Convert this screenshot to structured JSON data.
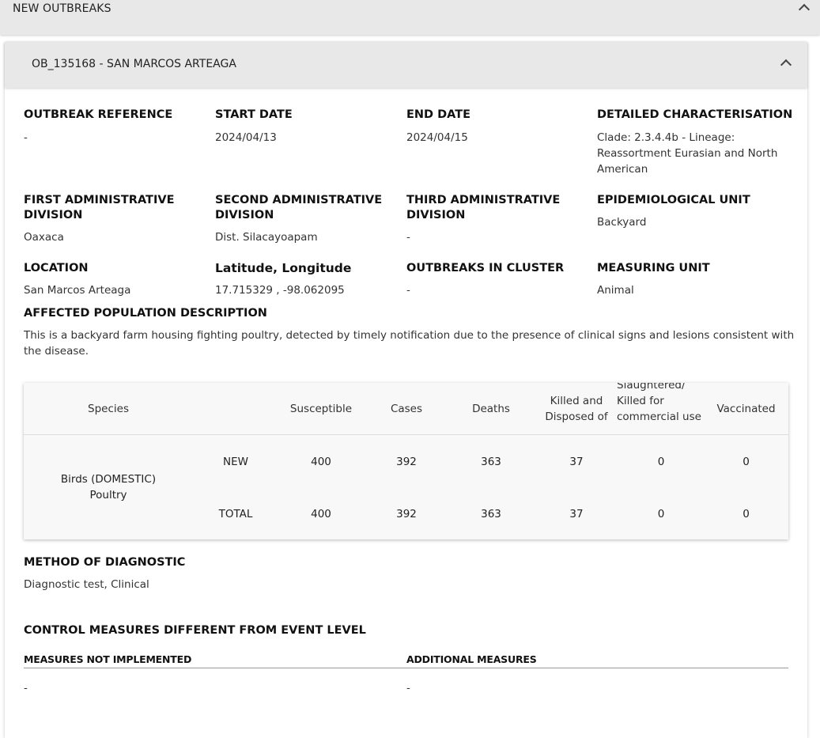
{
  "section_title": "NEW OUTBREAKS",
  "outbreak": {
    "title": "OB_135168 - SAN MARCOS ARTEAGA",
    "fields": {
      "outbreak_reference": {
        "label": "OUTBREAK REFERENCE",
        "value": "-"
      },
      "start_date": {
        "label": "START DATE",
        "value": "2024/04/13"
      },
      "end_date": {
        "label": "END DATE",
        "value": "2024/04/15"
      },
      "detailed_characterisation": {
        "label": "DETAILED CHARACTERISATION",
        "value": "Clade: 2.3.4.4b - Lineage: Reassortment Eurasian and North American"
      },
      "first_admin_division": {
        "label": "FIRST ADMINISTRATIVE DIVISION",
        "value": "Oaxaca"
      },
      "second_admin_division": {
        "label": "SECOND ADMINISTRATIVE DIVISION",
        "value": "Dist. Silacayoapam"
      },
      "third_admin_division": {
        "label": "THIRD ADMINISTRATIVE DIVISION",
        "value": "-"
      },
      "epidemiological_unit": {
        "label": "EPIDEMIOLOGICAL UNIT",
        "value": "Backyard"
      },
      "location": {
        "label": "LOCATION",
        "value": "San Marcos Arteaga"
      },
      "lat_long": {
        "label": "Latitude, Longitude",
        "value": "17.715329 , -98.062095"
      },
      "outbreaks_in_cluster": {
        "label": "OUTBREAKS IN CLUSTER",
        "value": "-"
      },
      "measuring_unit": {
        "label": "MEASURING UNIT",
        "value": "Animal"
      }
    },
    "affected_population": {
      "label": "AFFECTED POPULATION DESCRIPTION",
      "value": "This is a backyard farm housing fighting poultry, detected by timely notification due to the presence of clinical signs and lesions consistent with the disease."
    },
    "table": {
      "headers": {
        "species": "Species",
        "susceptible": "Susceptible",
        "cases": "Cases",
        "deaths": "Deaths",
        "killed": "Killed and Disposed of",
        "slaughtered": "Slaughtered/ Killed for commercial use",
        "vaccinated": "Vaccinated"
      },
      "species": "Birds (DOMESTIC) Poultry",
      "rows": [
        {
          "type": "NEW",
          "susceptible": "400",
          "cases": "392",
          "deaths": "363",
          "killed": "37",
          "slaughtered": "0",
          "vaccinated": "0"
        },
        {
          "type": "TOTAL",
          "susceptible": "400",
          "cases": "392",
          "deaths": "363",
          "killed": "37",
          "slaughtered": "0",
          "vaccinated": "0"
        }
      ]
    },
    "method_of_diagnostic": {
      "label": "METHOD OF DIAGNOSTIC",
      "value": "Diagnostic test, Clinical"
    },
    "control_measures": {
      "title": "CONTROL MEASURES DIFFERENT FROM EVENT LEVEL",
      "not_implemented": {
        "label": "MEASURES NOT IMPLEMENTED",
        "value": "-"
      },
      "additional": {
        "label": "ADDITIONAL MEASURES",
        "value": "-"
      }
    }
  }
}
